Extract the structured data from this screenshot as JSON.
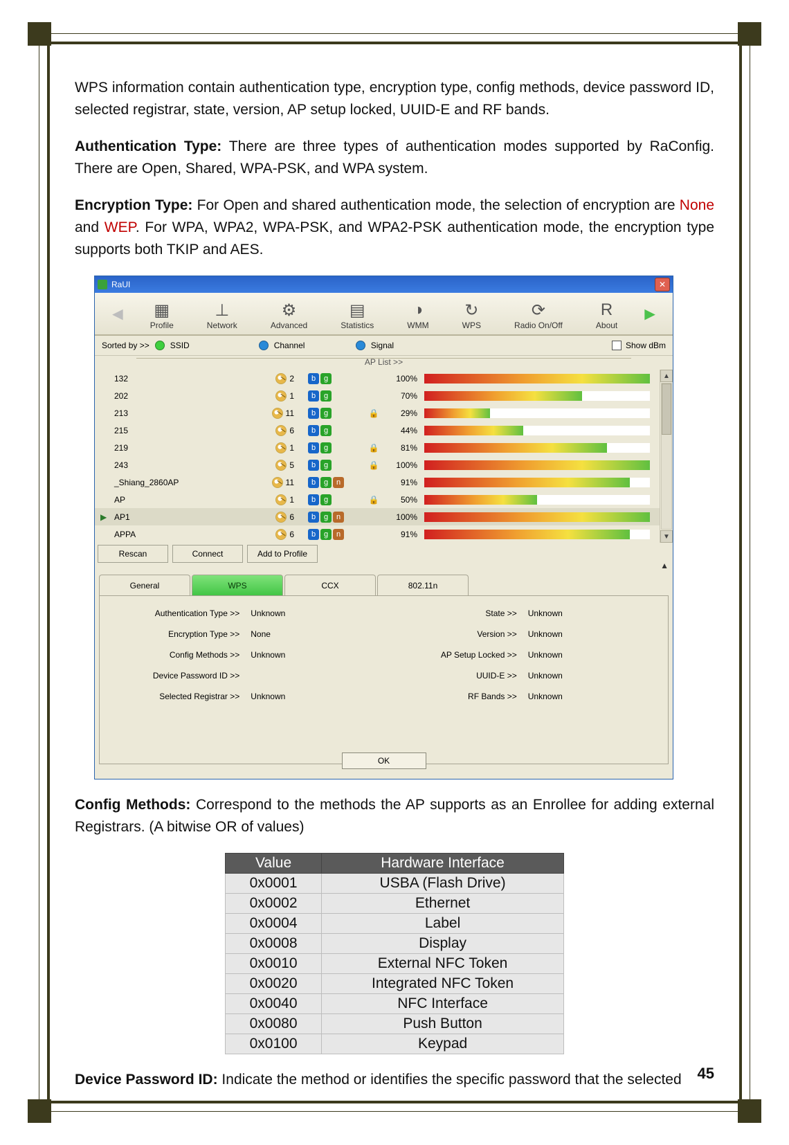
{
  "page_number": "45",
  "paragraphs": {
    "p1": "WPS information contain authentication type, encryption type, config methods, device password ID, selected registrar, state, version, AP setup locked, UUID-E and RF bands.",
    "auth_label": "Authentication Type:",
    "auth_text": " There are three types of authentication modes supported by RaConfig. There are Open, Shared, WPA-PSK, and WPA system.",
    "enc_label": "Encryption Type:",
    "enc_pre": " For Open and shared authentication mode, the selection of encryption are ",
    "enc_none": "None",
    "enc_and": " and ",
    "enc_wep": "WEP",
    "enc_post": ". For WPA, WPA2, WPA-PSK, and WPA2-PSK authentication mode, the encryption type supports both TKIP and AES.",
    "cfg_label": "Config Methods:",
    "cfg_text": " Correspond to the methods the AP supports as an Enrollee for adding external Registrars. (A bitwise OR of values)",
    "dpid_label": "Device Password ID:",
    "dpid_text": " Indicate the method or identifies the specific password that the selected"
  },
  "window": {
    "title": "RaUI",
    "close": "✕",
    "toolbar": [
      {
        "icon": "▦",
        "label": "Profile"
      },
      {
        "icon": "⊥",
        "label": "Network"
      },
      {
        "icon": "⚙",
        "label": "Advanced"
      },
      {
        "icon": "▤",
        "label": "Statistics"
      },
      {
        "icon": "◑",
        "label": "WMM"
      },
      {
        "icon": "↻",
        "label": "WPS"
      },
      {
        "icon": "⟳",
        "label": "Radio On/Off"
      },
      {
        "icon": "R",
        "label": "About"
      }
    ],
    "sort": {
      "label": "Sorted by >>",
      "ssid": "SSID",
      "channel": "Channel",
      "signal": "Signal",
      "showdbm": "Show dBm"
    },
    "aplist_label": "AP List >>",
    "ap_rows": [
      {
        "ssid": "132",
        "ch": "2",
        "modes": [
          "b",
          "g"
        ],
        "lock": false,
        "pct": 100
      },
      {
        "ssid": "202",
        "ch": "1",
        "modes": [
          "b",
          "g"
        ],
        "lock": false,
        "pct": 70
      },
      {
        "ssid": "213",
        "ch": "11",
        "modes": [
          "b",
          "g"
        ],
        "lock": true,
        "pct": 29
      },
      {
        "ssid": "215",
        "ch": "6",
        "modes": [
          "b",
          "g"
        ],
        "lock": false,
        "pct": 44
      },
      {
        "ssid": "219",
        "ch": "1",
        "modes": [
          "b",
          "g"
        ],
        "lock": true,
        "pct": 81
      },
      {
        "ssid": "243",
        "ch": "5",
        "modes": [
          "b",
          "g"
        ],
        "lock": true,
        "pct": 100
      },
      {
        "ssid": "_Shiang_2860AP",
        "ch": "11",
        "modes": [
          "b",
          "g",
          "n"
        ],
        "lock": false,
        "pct": 91
      },
      {
        "ssid": "AP",
        "ch": "1",
        "modes": [
          "b",
          "g"
        ],
        "lock": true,
        "pct": 50
      },
      {
        "ssid": "AP1",
        "ch": "6",
        "modes": [
          "b",
          "g",
          "n"
        ],
        "lock": false,
        "pct": 100,
        "selected": true
      },
      {
        "ssid": "APPA",
        "ch": "6",
        "modes": [
          "b",
          "g",
          "n"
        ],
        "lock": false,
        "pct": 91
      }
    ],
    "buttons": {
      "rescan": "Rescan",
      "connect": "Connect",
      "addprofile": "Add to Profile"
    },
    "tabs": {
      "general": "General",
      "wps": "WPS",
      "ccx": "CCX",
      "dot11n": "802.11n"
    },
    "wps": {
      "left": [
        {
          "l": "Authentication Type >>",
          "v": "Unknown"
        },
        {
          "l": "Encryption Type >>",
          "v": "None"
        },
        {
          "l": "Config Methods >>",
          "v": "Unknown"
        },
        {
          "l": "Device Password ID >>",
          "v": ""
        },
        {
          "l": "Selected Registrar >>",
          "v": "Unknown"
        }
      ],
      "right": [
        {
          "l": "State >>",
          "v": "Unknown"
        },
        {
          "l": "Version >>",
          "v": "Unknown"
        },
        {
          "l": "AP Setup Locked >>",
          "v": "Unknown"
        },
        {
          "l": "UUID-E >>",
          "v": "Unknown"
        },
        {
          "l": "RF Bands >>",
          "v": "Unknown"
        }
      ]
    },
    "ok": "OK"
  },
  "cm_table": {
    "headers": [
      "Value",
      "Hardware Interface"
    ],
    "rows": [
      [
        "0x0001",
        "USBA (Flash Drive)"
      ],
      [
        "0x0002",
        "Ethernet"
      ],
      [
        "0x0004",
        "Label"
      ],
      [
        "0x0008",
        "Display"
      ],
      [
        "0x0010",
        "External NFC Token"
      ],
      [
        "0x0020",
        "Integrated NFC Token"
      ],
      [
        "0x0040",
        "NFC Interface"
      ],
      [
        "0x0080",
        "Push Button"
      ],
      [
        "0x0100",
        "Keypad"
      ]
    ]
  }
}
